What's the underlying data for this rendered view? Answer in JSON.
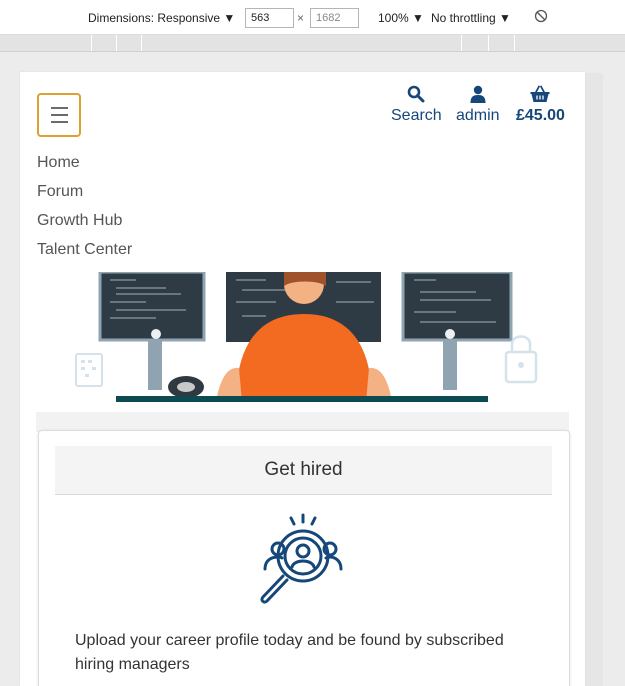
{
  "devtools": {
    "dimensions_label": "Dimensions: Responsive ▼",
    "width": "563",
    "height": "1682",
    "separator": "×",
    "zoom": "100% ▼",
    "throttling": "No throttling ▼"
  },
  "header": {
    "menu_label": "",
    "search_label": "Search",
    "account_label": "admin",
    "basket_label": "£45.00"
  },
  "nav": {
    "items": [
      "Home",
      "Forum",
      "Growth Hub",
      "Talent Center"
    ]
  },
  "card": {
    "title": "Get hired",
    "description": "Upload your career profile today and be found by subscribed hiring managers"
  },
  "colors": {
    "brand_blue": "#16477a",
    "hamburger_border": "#e0a030",
    "hero_orange": "#f26b21"
  },
  "icons": [
    "menu-icon",
    "search-icon",
    "user-icon",
    "basket-icon",
    "talent-search-icon",
    "no-throttling-icon"
  ]
}
